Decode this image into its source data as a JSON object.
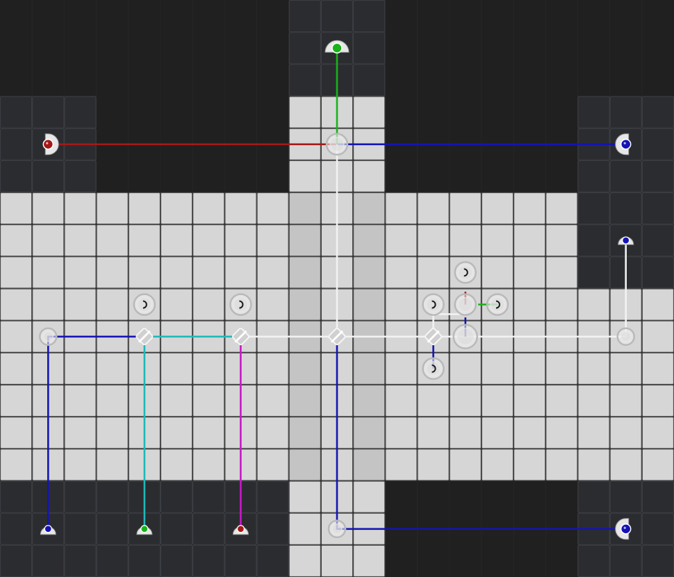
{
  "game": {
    "title": "",
    "grid": {
      "cols": 21,
      "rows": 18
    },
    "colors": {
      "void": "#202020",
      "dark_tile": "#2b2c30",
      "dark_grid": "#3b3d42",
      "light_tile": "#d6d6d6",
      "light_grid": "#4a4a4a",
      "shaded_tile": "#c4c4c4",
      "red": "#a51818",
      "green": "#19b319",
      "blue": "#1414b4",
      "cyan": "#1fb8b8",
      "magenta": "#c719c7",
      "white_beam": "#f2f2f2"
    },
    "emitters": [
      {
        "name": "emitter-red-left",
        "color": "red",
        "col": 1,
        "row": 4
      },
      {
        "name": "emitter-green-top",
        "color": "green",
        "col": 10,
        "row": 1
      },
      {
        "name": "emitter-blue-right",
        "color": "blue",
        "col": 19,
        "row": 4
      },
      {
        "name": "emitter-blue-bottom-right",
        "color": "blue",
        "col": 19,
        "row": 16
      }
    ],
    "receivers": [
      {
        "name": "receiver-blue-right",
        "color": "blue",
        "col": 19,
        "row": 7
      },
      {
        "name": "receiver-blue-bottom-left",
        "color": "blue",
        "col": 1,
        "row": 16
      },
      {
        "name": "receiver-green-bottom",
        "color": "green",
        "col": 4,
        "row": 16
      },
      {
        "name": "receiver-red-bottom",
        "color": "red",
        "col": 7,
        "row": 16
      }
    ],
    "components": [
      {
        "name": "combiner-top",
        "kind": "combiner",
        "col": 10,
        "row": 4
      },
      {
        "name": "splitter-1",
        "kind": "splitter",
        "col": 4,
        "row": 10
      },
      {
        "name": "splitter-2",
        "kind": "splitter",
        "col": 7,
        "row": 10
      },
      {
        "name": "splitter-3",
        "kind": "splitter",
        "col": 10,
        "row": 10
      },
      {
        "name": "splitter-4",
        "kind": "splitter",
        "col": 13,
        "row": 10
      },
      {
        "name": "prism",
        "kind": "prism",
        "col": 14,
        "row": 9
      },
      {
        "name": "mirror-left",
        "kind": "mirror",
        "col": 1,
        "row": 10
      },
      {
        "name": "mirror-right",
        "kind": "mirror",
        "col": 19,
        "row": 10
      },
      {
        "name": "mirror-bottom",
        "kind": "mirror",
        "col": 10,
        "row": 16
      },
      {
        "name": "junction",
        "kind": "node",
        "col": 14,
        "row": 10
      },
      {
        "name": "spare-piece-1",
        "kind": "spare",
        "col": 4,
        "row": 9
      },
      {
        "name": "spare-piece-2",
        "kind": "spare",
        "col": 7,
        "row": 9
      },
      {
        "name": "spare-piece-3",
        "kind": "spare",
        "col": 14,
        "row": 8
      },
      {
        "name": "spare-piece-4",
        "kind": "spare",
        "col": 13,
        "row": 9
      },
      {
        "name": "spare-piece-5",
        "kind": "spare",
        "col": 15,
        "row": 9
      },
      {
        "name": "spare-piece-6",
        "kind": "spare",
        "col": 13,
        "row": 11
      }
    ],
    "beams": [
      {
        "name": "beam-red",
        "color": "red",
        "points": [
          [
            1,
            4
          ],
          [
            10,
            4
          ]
        ]
      },
      {
        "name": "beam-green",
        "color": "green",
        "points": [
          [
            10,
            1
          ],
          [
            10,
            4
          ]
        ]
      },
      {
        "name": "beam-blue-top",
        "color": "blue",
        "points": [
          [
            19,
            4
          ],
          [
            10,
            4
          ]
        ]
      },
      {
        "name": "beam-white-down",
        "color": "white_beam",
        "points": [
          [
            10,
            4
          ],
          [
            10,
            10
          ]
        ]
      },
      {
        "name": "beam-white-horizontal",
        "color": "white_beam",
        "points": [
          [
            4,
            10
          ],
          [
            19,
            10
          ]
        ]
      },
      {
        "name": "beam-white-right",
        "color": "white_beam",
        "points": [
          [
            19,
            10
          ],
          [
            19,
            7
          ]
        ]
      },
      {
        "name": "beam-white-prism",
        "color": "white_beam",
        "points": [
          [
            13,
            10
          ],
          [
            13,
            9.3
          ],
          [
            14,
            9.3
          ]
        ]
      },
      {
        "name": "beam-blue-left",
        "color": "blue",
        "points": [
          [
            4,
            10
          ],
          [
            1,
            10
          ],
          [
            1,
            16
          ]
        ]
      },
      {
        "name": "beam-cyan",
        "color": "cyan",
        "points": [
          [
            7,
            10
          ],
          [
            4,
            10
          ],
          [
            4,
            16
          ]
        ]
      },
      {
        "name": "beam-magenta",
        "color": "magenta",
        "points": [
          [
            7,
            10
          ],
          [
            7,
            16
          ]
        ]
      },
      {
        "name": "beam-blue-bottom",
        "color": "blue",
        "points": [
          [
            10,
            10
          ],
          [
            10,
            16
          ],
          [
            19,
            16
          ]
        ]
      },
      {
        "name": "beam-blue-short",
        "color": "blue",
        "points": [
          [
            13,
            10
          ],
          [
            13,
            11
          ]
        ]
      },
      {
        "name": "beam-prism-red",
        "color": "red",
        "points": [
          [
            14,
            8.6
          ],
          [
            14,
            9
          ]
        ]
      },
      {
        "name": "beam-prism-green",
        "color": "green",
        "points": [
          [
            14.4,
            9
          ],
          [
            15,
            9
          ]
        ]
      },
      {
        "name": "beam-prism-blue",
        "color": "blue",
        "points": [
          [
            14,
            9.4
          ],
          [
            14,
            10
          ]
        ]
      }
    ]
  }
}
